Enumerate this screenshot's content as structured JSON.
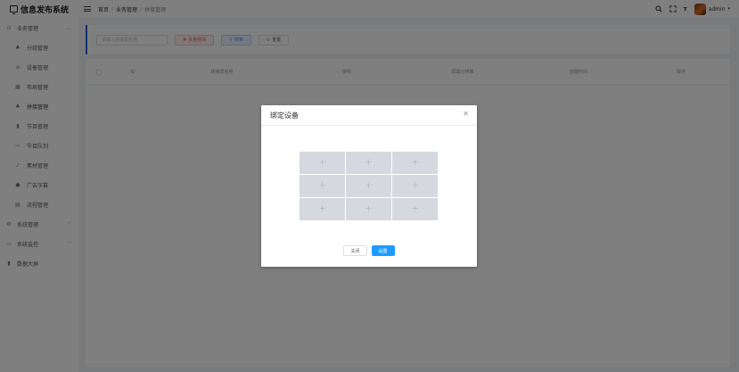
{
  "app": {
    "title": "信息发布系统"
  },
  "header": {
    "breadcrumb": [
      "首页",
      "业务管理",
      "拼接管理"
    ],
    "user": "admin"
  },
  "sidebar": {
    "items": [
      {
        "label": "业务管理",
        "icon": "grid-icon",
        "level": "top",
        "expanded": true
      },
      {
        "label": "分组管理",
        "icon": "people-icon",
        "level": "sub"
      },
      {
        "label": "设备管理",
        "icon": "device-icon",
        "level": "sub"
      },
      {
        "label": "布局管理",
        "icon": "layout-icon",
        "level": "sub"
      },
      {
        "label": "拼接管理",
        "icon": "splice-icon",
        "level": "sub",
        "active": true
      },
      {
        "label": "节目管理",
        "icon": "program-icon",
        "level": "sub"
      },
      {
        "label": "节目队列",
        "icon": "queue-icon",
        "level": "sub"
      },
      {
        "label": "素材管理",
        "icon": "music-icon",
        "level": "sub"
      },
      {
        "label": "广告字幕",
        "icon": "subtitle-icon",
        "level": "sub"
      },
      {
        "label": "流程管理",
        "icon": "flow-icon",
        "level": "sub"
      },
      {
        "label": "系统管理",
        "icon": "gear-icon",
        "level": "top",
        "expanded": false
      },
      {
        "label": "系统监控",
        "icon": "monitor-icon",
        "level": "top",
        "expanded": false
      },
      {
        "label": "数据大屏",
        "icon": "chart-icon",
        "level": "top"
      }
    ]
  },
  "search": {
    "placeholder": "请输入拼接屏名称",
    "delete_label": "批量删除",
    "search_label": "搜索",
    "reset_label": "重置"
  },
  "table": {
    "columns": [
      "ID",
      "拼接屏名称",
      "架构",
      "屏幕分辨率",
      "创建时间",
      "操作"
    ]
  },
  "dialog": {
    "title": "绑定设备",
    "grid_rows": 3,
    "grid_cols": 3,
    "cell_symbol": "+",
    "close_label": "关闭",
    "confirm_label": "设置"
  },
  "colors": {
    "accent": "#1e62e6",
    "primary": "#1e9bff",
    "danger": "#f56c6c",
    "overlay": "rgba(0,0,0,0.5)"
  }
}
